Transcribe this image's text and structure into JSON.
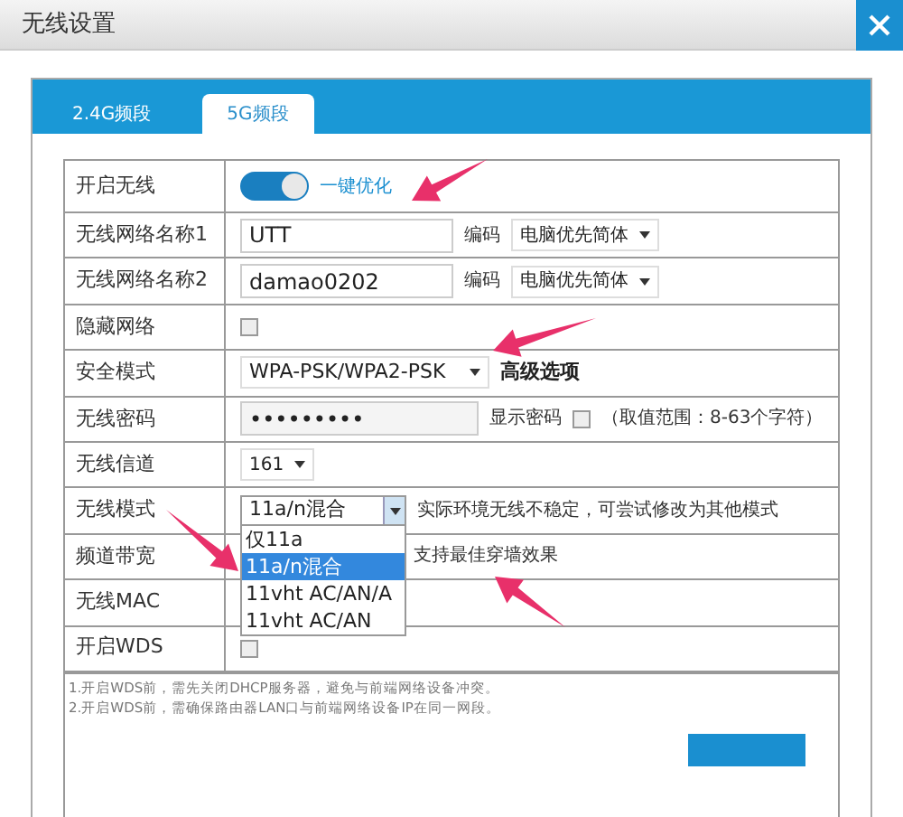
{
  "window": {
    "title": "无线设置"
  },
  "tabs": [
    {
      "label": "2.4G频段",
      "selected": false
    },
    {
      "label": "5G频段",
      "selected": true
    }
  ],
  "rows": [
    {
      "kind": "toggle",
      "label": "开启无线",
      "on": true,
      "link": "一键优化"
    },
    {
      "kind": "name",
      "label": "无线网络名称1",
      "value": "UTT",
      "select_label": "编码",
      "select": "电脑优先简体"
    },
    {
      "kind": "name",
      "label": "无线网络名称2",
      "value": "damao0202",
      "select_label": "编码",
      "select": "电脑优先简体"
    },
    {
      "kind": "checkbox",
      "label": "隐藏网络",
      "checked": false
    },
    {
      "kind": "select_link",
      "label": "安全模式",
      "select": "WPA-PSK/WPA2-PSK",
      "link": "高级选项"
    },
    {
      "kind": "password",
      "label": "无线密码",
      "value": "•••••••••",
      "show_label": "显示密码",
      "checked": false,
      "hint": "（取值范围：8-63个字符）"
    },
    {
      "kind": "select",
      "label": "无线信道",
      "select": "161"
    },
    {
      "kind": "dropdown",
      "label": "无线模式",
      "select": "11a/n混合",
      "hint": "实际环境无线不稳定，可尝试修改为其他模式",
      "expanded": true,
      "options": [
        {
          "label": "仅11a",
          "selected": false
        },
        {
          "label": "11a/n混合",
          "selected": true
        },
        {
          "label": "11vht AC/AN/A",
          "selected": false
        },
        {
          "label": "11vht AC/AN",
          "selected": false
        }
      ]
    },
    {
      "kind": "hint",
      "label": "频道带宽",
      "hint": "支持最佳穿墙效果"
    },
    {
      "kind": "empty",
      "label": "无线MAC"
    },
    {
      "kind": "checkbox",
      "label": "开启WDS",
      "checked": false
    }
  ],
  "notes": [
    "1.开启WDS前，需先关闭DHCP服务器，避免与前端网络设备冲突。",
    "2.开启WDS前，需确保路由器LAN口与前端网络设备IP在同一网段。"
  ]
}
